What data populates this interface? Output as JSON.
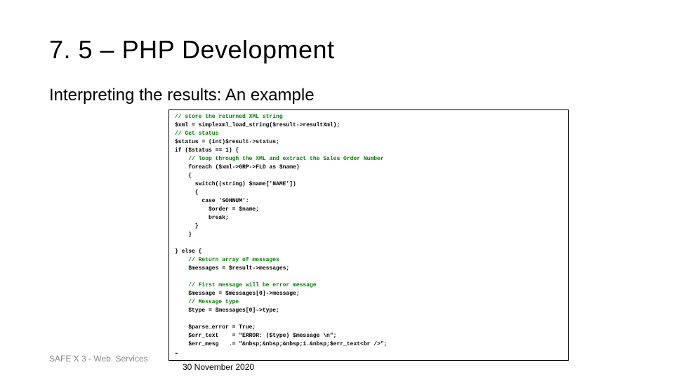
{
  "slide": {
    "title": "7. 5 – PHP Development",
    "subtitle": "Interpreting the results: An example",
    "code": {
      "l1": "// store the returned XML string",
      "l2": "$xml = simplexml_load_string($result->resultXml);",
      "l3": "// Get status",
      "l4": "$status = (int)$result->status;",
      "l5": "if ($status == 1) {",
      "l6": "    // loop through the XML and extract the Sales Order Number",
      "l7": "    foreach ($xml->GRP->FLD as $name)",
      "l8": "    {",
      "l9": "      switch((string) $name['NAME'])",
      "l10": "      {",
      "l11": "        case 'SOHNUM':",
      "l12": "          $order = $name;",
      "l13": "          break;",
      "l14": "      }",
      "l15": "    }",
      "l16": "",
      "l17": "} else {",
      "l18": "    // Return array of messages",
      "l19": "    $messages = $result->messages;",
      "l20": "",
      "l21": "    // First message will be error message",
      "l22": "    $message = $messages[0]->message;",
      "l23": "    // Message type",
      "l24": "    $type = $messages[0]->type;",
      "l25": "",
      "l26": "    $parse_error = True;",
      "l27": "    $err_text    = \"ERROR: ($type) $message \\n\";",
      "l28": "    $err_mesg   .= \"&nbsp;&nbsp;&nbsp;1.&nbsp;$err_text<br />\";",
      "l29": "…"
    },
    "footer_left": "SAFE X 3 - Web. Services",
    "footer_date": "30 November 2020"
  }
}
